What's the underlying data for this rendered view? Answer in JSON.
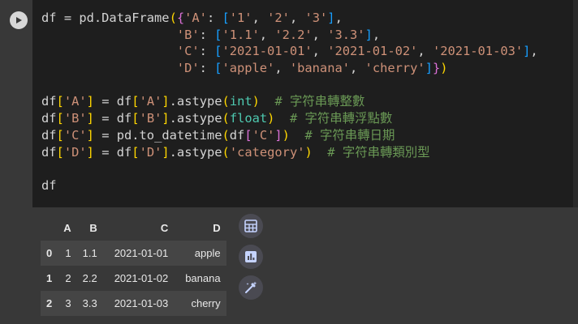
{
  "cell": {
    "run_button_icon": "play-icon",
    "code_lines": [
      [
        {
          "t": "df",
          "c": "t-plain"
        },
        {
          "t": " = ",
          "c": "t-plain"
        },
        {
          "t": "pd.DataFrame",
          "c": "t-plain"
        },
        {
          "t": "(",
          "c": "t-b1"
        },
        {
          "t": "{",
          "c": "t-b2"
        },
        {
          "t": "'A'",
          "c": "t-str"
        },
        {
          "t": ": ",
          "c": "t-plain"
        },
        {
          "t": "[",
          "c": "t-b3"
        },
        {
          "t": "'1'",
          "c": "t-str"
        },
        {
          "t": ", ",
          "c": "t-plain"
        },
        {
          "t": "'2'",
          "c": "t-str"
        },
        {
          "t": ", ",
          "c": "t-plain"
        },
        {
          "t": "'3'",
          "c": "t-str"
        },
        {
          "t": "]",
          "c": "t-b3"
        },
        {
          "t": ",",
          "c": "t-plain"
        }
      ],
      [
        {
          "t": "                  ",
          "c": "t-plain"
        },
        {
          "t": "'B'",
          "c": "t-str"
        },
        {
          "t": ": ",
          "c": "t-plain"
        },
        {
          "t": "[",
          "c": "t-b3"
        },
        {
          "t": "'1.1'",
          "c": "t-str"
        },
        {
          "t": ", ",
          "c": "t-plain"
        },
        {
          "t": "'2.2'",
          "c": "t-str"
        },
        {
          "t": ", ",
          "c": "t-plain"
        },
        {
          "t": "'3.3'",
          "c": "t-str"
        },
        {
          "t": "]",
          "c": "t-b3"
        },
        {
          "t": ",",
          "c": "t-plain"
        }
      ],
      [
        {
          "t": "                  ",
          "c": "t-plain"
        },
        {
          "t": "'C'",
          "c": "t-str"
        },
        {
          "t": ": ",
          "c": "t-plain"
        },
        {
          "t": "[",
          "c": "t-b3"
        },
        {
          "t": "'2021-01-01'",
          "c": "t-str"
        },
        {
          "t": ", ",
          "c": "t-plain"
        },
        {
          "t": "'2021-01-02'",
          "c": "t-str"
        },
        {
          "t": ", ",
          "c": "t-plain"
        },
        {
          "t": "'2021-01-03'",
          "c": "t-str"
        },
        {
          "t": "]",
          "c": "t-b3"
        },
        {
          "t": ",",
          "c": "t-plain"
        }
      ],
      [
        {
          "t": "                  ",
          "c": "t-plain"
        },
        {
          "t": "'D'",
          "c": "t-str"
        },
        {
          "t": ": ",
          "c": "t-plain"
        },
        {
          "t": "[",
          "c": "t-b3"
        },
        {
          "t": "'apple'",
          "c": "t-str"
        },
        {
          "t": ", ",
          "c": "t-plain"
        },
        {
          "t": "'banana'",
          "c": "t-str"
        },
        {
          "t": ", ",
          "c": "t-plain"
        },
        {
          "t": "'cherry'",
          "c": "t-str"
        },
        {
          "t": "]",
          "c": "t-b3"
        },
        {
          "t": "}",
          "c": "t-b2"
        },
        {
          "t": ")",
          "c": "t-b1"
        }
      ],
      [],
      [
        {
          "t": "df",
          "c": "t-plain"
        },
        {
          "t": "[",
          "c": "t-b1"
        },
        {
          "t": "'A'",
          "c": "t-str"
        },
        {
          "t": "]",
          "c": "t-b1"
        },
        {
          "t": " = ",
          "c": "t-plain"
        },
        {
          "t": "df",
          "c": "t-plain"
        },
        {
          "t": "[",
          "c": "t-b1"
        },
        {
          "t": "'A'",
          "c": "t-str"
        },
        {
          "t": "]",
          "c": "t-b1"
        },
        {
          "t": ".astype",
          "c": "t-plain"
        },
        {
          "t": "(",
          "c": "t-b1"
        },
        {
          "t": "int",
          "c": "t-bi"
        },
        {
          "t": ")",
          "c": "t-b1"
        },
        {
          "t": "  # 字符串轉整數",
          "c": "t-com"
        }
      ],
      [
        {
          "t": "df",
          "c": "t-plain"
        },
        {
          "t": "[",
          "c": "t-b1"
        },
        {
          "t": "'B'",
          "c": "t-str"
        },
        {
          "t": "]",
          "c": "t-b1"
        },
        {
          "t": " = ",
          "c": "t-plain"
        },
        {
          "t": "df",
          "c": "t-plain"
        },
        {
          "t": "[",
          "c": "t-b1"
        },
        {
          "t": "'B'",
          "c": "t-str"
        },
        {
          "t": "]",
          "c": "t-b1"
        },
        {
          "t": ".astype",
          "c": "t-plain"
        },
        {
          "t": "(",
          "c": "t-b1"
        },
        {
          "t": "float",
          "c": "t-bi"
        },
        {
          "t": ")",
          "c": "t-b1"
        },
        {
          "t": "  # 字符串轉浮點數",
          "c": "t-com"
        }
      ],
      [
        {
          "t": "df",
          "c": "t-plain"
        },
        {
          "t": "[",
          "c": "t-b1"
        },
        {
          "t": "'C'",
          "c": "t-str"
        },
        {
          "t": "]",
          "c": "t-b1"
        },
        {
          "t": " = ",
          "c": "t-plain"
        },
        {
          "t": "pd.to_datetime",
          "c": "t-plain"
        },
        {
          "t": "(",
          "c": "t-b1"
        },
        {
          "t": "df",
          "c": "t-plain"
        },
        {
          "t": "[",
          "c": "t-b2"
        },
        {
          "t": "'C'",
          "c": "t-str"
        },
        {
          "t": "]",
          "c": "t-b2"
        },
        {
          "t": ")",
          "c": "t-b1"
        },
        {
          "t": "  # 字符串轉日期",
          "c": "t-com"
        }
      ],
      [
        {
          "t": "df",
          "c": "t-plain"
        },
        {
          "t": "[",
          "c": "t-b1"
        },
        {
          "t": "'D'",
          "c": "t-str"
        },
        {
          "t": "]",
          "c": "t-b1"
        },
        {
          "t": " = ",
          "c": "t-plain"
        },
        {
          "t": "df",
          "c": "t-plain"
        },
        {
          "t": "[",
          "c": "t-b1"
        },
        {
          "t": "'D'",
          "c": "t-str"
        },
        {
          "t": "]",
          "c": "t-b1"
        },
        {
          "t": ".astype",
          "c": "t-plain"
        },
        {
          "t": "(",
          "c": "t-b1"
        },
        {
          "t": "'category'",
          "c": "t-str"
        },
        {
          "t": ")",
          "c": "t-b1"
        },
        {
          "t": "  # 字符串轉類別型",
          "c": "t-com"
        }
      ],
      [],
      [
        {
          "t": "df",
          "c": "t-plain"
        }
      ]
    ]
  },
  "output": {
    "table": {
      "columns": [
        "",
        "A",
        "B",
        "C",
        "D"
      ],
      "rows": [
        {
          "index": "0",
          "A": "1",
          "B": "1.1",
          "C": "2021-01-01",
          "D": "apple"
        },
        {
          "index": "1",
          "A": "2",
          "B": "2.2",
          "C": "2021-01-02",
          "D": "banana"
        },
        {
          "index": "2",
          "A": "3",
          "B": "3.3",
          "C": "2021-01-03",
          "D": "cherry"
        }
      ]
    },
    "toolbar_icons": [
      "table-icon",
      "chart-icon",
      "magic-wand-icon"
    ]
  },
  "colors": {
    "editor_bg": "#1e1e1e",
    "output_bg": "#383838",
    "string": "#ce9178",
    "builtin": "#4ec9b0",
    "comment": "#6a9955"
  }
}
